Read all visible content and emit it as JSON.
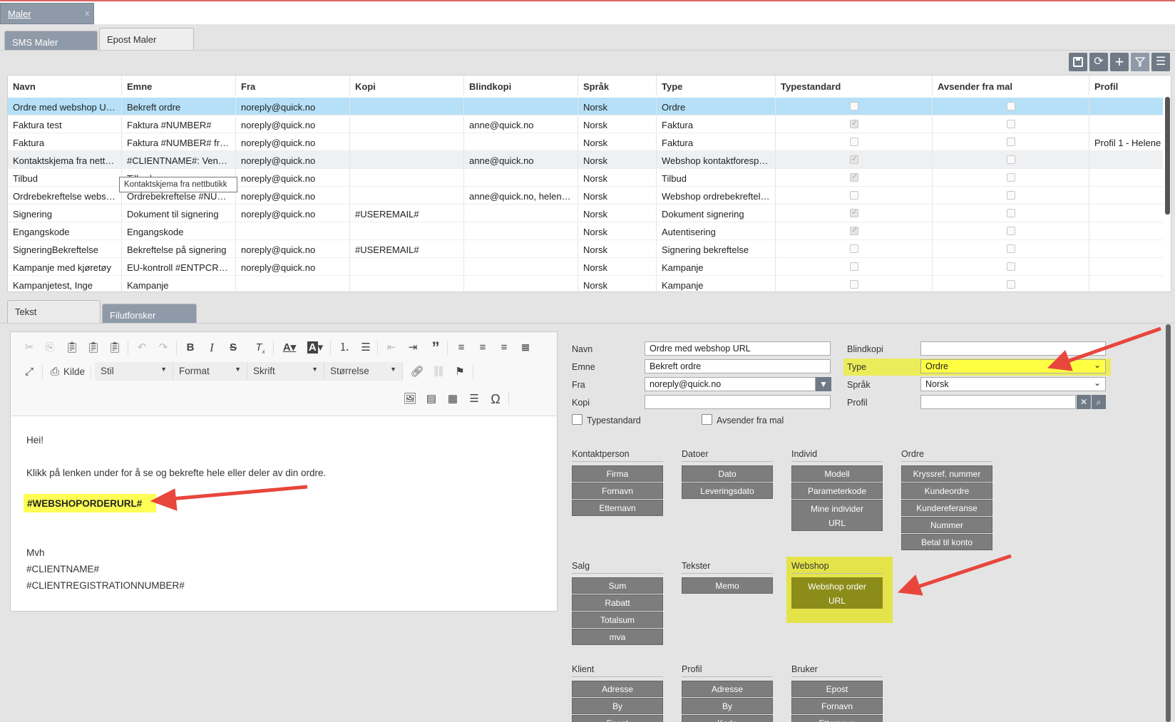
{
  "top_tab": {
    "label": "Maler",
    "close": "x"
  },
  "sub_tabs": [
    {
      "label": "SMS Maler"
    },
    {
      "label": "Epost Maler"
    }
  ],
  "toolbar_icons": [
    "save-icon",
    "refresh-icon",
    "add-icon",
    "filter-icon",
    "menu-icon"
  ],
  "grid": {
    "columns": [
      "Navn",
      "Emne",
      "Fra",
      "Kopi",
      "Blindkopi",
      "Språk",
      "Type",
      "Typestandard",
      "Avsender fra mal",
      "Profil"
    ],
    "rows": [
      {
        "navn": "Ordre med webshop URL",
        "emne": "Bekreft ordre",
        "fra": "noreply@quick.no",
        "kopi": "",
        "blindkopi": "",
        "sprak": "Norsk",
        "type": "Ordre",
        "typestandard": false,
        "avsender": false,
        "profil": ""
      },
      {
        "navn": "Faktura test",
        "emne": "Faktura #NUMBER#",
        "fra": "noreply@quick.no",
        "kopi": "",
        "blindkopi": "anne@quick.no",
        "sprak": "Norsk",
        "type": "Faktura",
        "typestandard": true,
        "avsender": false,
        "profil": ""
      },
      {
        "navn": "Faktura",
        "emne": "Faktura #NUMBER# fra #CLIENTNAME#",
        "fra": "noreply@quick.no",
        "kopi": "",
        "blindkopi": "",
        "sprak": "Norsk",
        "type": "Faktura",
        "typestandard": false,
        "avsender": false,
        "profil": "Profil 1 - Helene"
      },
      {
        "navn": "Kontaktskjema fra nettbutikk",
        "emne": "#CLIENTNAME#: Vennligst",
        "fra": "noreply@quick.no",
        "kopi": "",
        "blindkopi": "anne@quick.no",
        "sprak": "Norsk",
        "type": "Webshop kontaktforespørsel",
        "typestandard": true,
        "avsender": false,
        "profil": ""
      },
      {
        "navn": "Tilbud",
        "emne": "Tilbud",
        "fra": "noreply@quick.no",
        "kopi": "",
        "blindkopi": "",
        "sprak": "Norsk",
        "type": "Tilbud",
        "typestandard": true,
        "avsender": false,
        "profil": ""
      },
      {
        "navn": "Ordrebekreftelse webshop",
        "emne": "Ordrebekreftelse #NUMBER#",
        "fra": "noreply@quick.no",
        "kopi": "",
        "blindkopi": "anne@quick.no, helene@quick.no",
        "sprak": "Norsk",
        "type": "Webshop ordrebekreftelse",
        "typestandard": false,
        "avsender": false,
        "profil": ""
      },
      {
        "navn": "Signering",
        "emne": "Dokument til signering",
        "fra": "noreply@quick.no",
        "kopi": "#USEREMAIL#",
        "blindkopi": "",
        "sprak": "Norsk",
        "type": "Dokument signering",
        "typestandard": true,
        "avsender": false,
        "profil": ""
      },
      {
        "navn": "Engangskode",
        "emne": "Engangskode",
        "fra": "",
        "kopi": "",
        "blindkopi": "",
        "sprak": "Norsk",
        "type": "Autentisering",
        "typestandard": true,
        "avsender": false,
        "profil": ""
      },
      {
        "navn": "SigneringBekreftelse",
        "emne": "Bekreftelse på signering",
        "fra": "noreply@quick.no",
        "kopi": "#USEREMAIL#",
        "blindkopi": "",
        "sprak": "Norsk",
        "type": "Signering bekreftelse",
        "typestandard": false,
        "avsender": false,
        "profil": ""
      },
      {
        "navn": "Kampanje med kjøretøy",
        "emne": "EU-kontroll #ENTPCREATED#",
        "fra": "noreply@quick.no",
        "kopi": "",
        "blindkopi": "",
        "sprak": "Norsk",
        "type": "Kampanje",
        "typestandard": false,
        "avsender": false,
        "profil": ""
      },
      {
        "navn": "Kampanjetest, Inge",
        "emne": "Kampanje",
        "fra": "",
        "kopi": "",
        "blindkopi": "",
        "sprak": "Norsk",
        "type": "Kampanje",
        "typestandard": false,
        "avsender": false,
        "profil": ""
      }
    ],
    "tooltip": "Kontaktskjema fra nettbutikk"
  },
  "lower_tabs": [
    {
      "label": "Tekst"
    },
    {
      "label": "Filutforsker"
    }
  ],
  "editor": {
    "kilde_label": "Kilde",
    "dropdowns": [
      "Stil",
      "Format",
      "Skrift",
      "Størrelse"
    ],
    "body": {
      "greeting": "Hei!",
      "line1": "Klikk på lenken under for å se og bekrefte hele eller deler av din ordre.",
      "placeholder": "#WEBSHOPORDERURL#",
      "sign1": "Mvh",
      "sign2": "#CLIENTNAME#",
      "sign3": "#CLIENTREGISTRATIONNUMBER#"
    }
  },
  "form": {
    "navn_label": "Navn",
    "navn_value": "Ordre med webshop URL",
    "emne_label": "Emne",
    "emne_value": "Bekreft ordre",
    "fra_label": "Fra",
    "fra_value": "noreply@quick.no",
    "kopi_label": "Kopi",
    "kopi_value": "",
    "blindkopi_label": "Blindkopi",
    "blindkopi_value": "",
    "type_label": "Type",
    "type_value": "Ordre",
    "sprak_label": "Språk",
    "sprak_value": "Norsk",
    "profil_label": "Profil",
    "profil_value": "",
    "typestandard_label": "Typestandard",
    "avsender_label": "Avsender fra mal"
  },
  "field_groups": {
    "kontaktperson": {
      "title": "Kontaktperson",
      "buttons": [
        "Firma",
        "Fornavn",
        "Etternavn"
      ]
    },
    "datoer": {
      "title": "Datoer",
      "buttons": [
        "Dato",
        "Leveringsdato"
      ]
    },
    "individ": {
      "title": "Individ",
      "buttons": [
        "Modell",
        "Parameterkode"
      ],
      "tall_line1": "Mine individer",
      "tall_line2": "URL"
    },
    "ordre": {
      "title": "Ordre",
      "buttons": [
        "Kryssref. nummer",
        "Kundeordre",
        "Kundereferanse",
        "Nummer",
        "Betal til konto"
      ]
    },
    "salg": {
      "title": "Salg",
      "buttons": [
        "Sum",
        "Rabatt",
        "Totalsum",
        "mva"
      ]
    },
    "tekster": {
      "title": "Tekster",
      "buttons": [
        "Memo"
      ]
    },
    "webshop": {
      "title": "Webshop",
      "tall_line1": "Webshop order",
      "tall_line2": "URL"
    },
    "klient": {
      "title": "Klient",
      "buttons": [
        "Adresse",
        "By",
        "Epost"
      ]
    },
    "profil": {
      "title": "Profil",
      "buttons": [
        "Adresse",
        "By",
        "Kode"
      ]
    },
    "bruker": {
      "title": "Bruker",
      "buttons": [
        "Epost",
        "Fornavn",
        "Etternavn"
      ]
    }
  },
  "colors": {
    "highlight": "#ffff55",
    "selected_row": "#b5e0f7",
    "arrow": "#e8463c",
    "tab": "#8f9aa8",
    "field_button": "#7d7d7d"
  }
}
